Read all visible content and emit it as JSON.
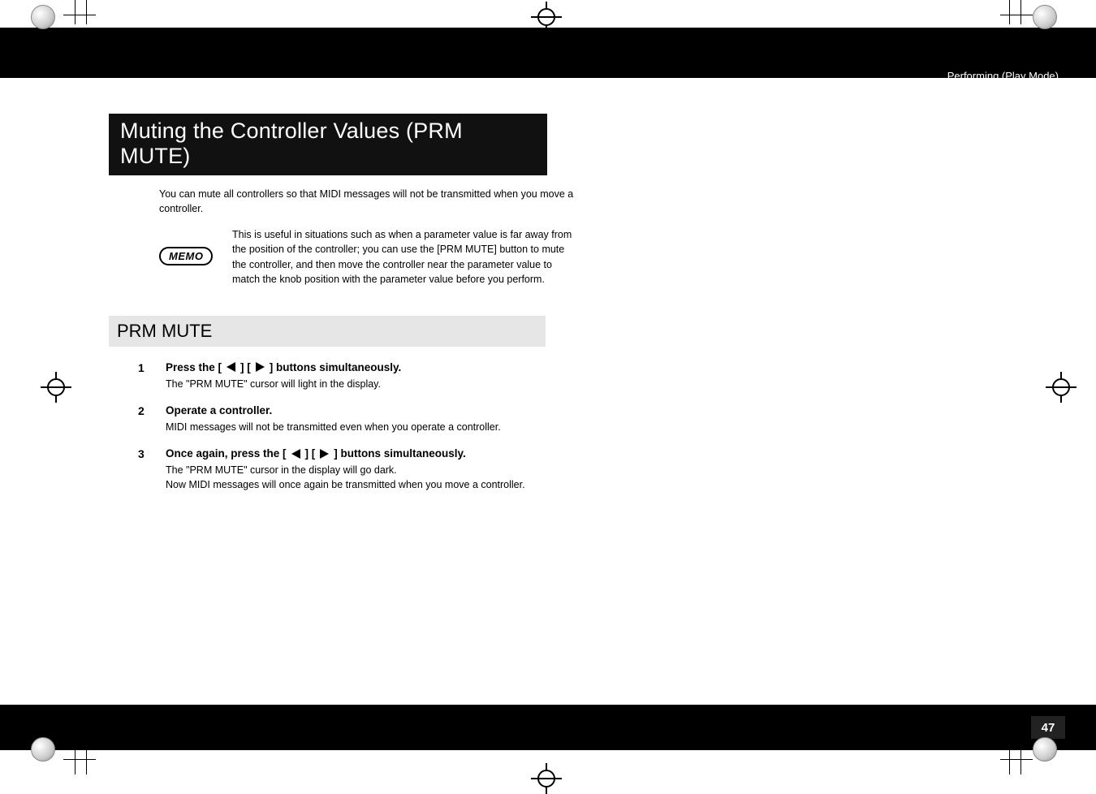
{
  "header": {
    "breadcrumb": "Performing (Play Mode)"
  },
  "main": {
    "title": "Muting the Controller Values (PRM MUTE)",
    "intro": "You can mute all controllers so that MIDI messages will not be transmitted when you move a controller.",
    "memo_label": "MEMO",
    "memo_text": "This is useful in situations such as when a parameter value is far away from the position of the controller; you can use the [PRM MUTE] button to mute the controller, and then move the controller near the parameter value to match the knob position with the parameter value before you perform."
  },
  "section": {
    "title": "PRM MUTE",
    "steps": [
      {
        "num": "1",
        "title_prefix": "Press the [",
        "title_mid": "] [",
        "title_suffix": "] buttons simultaneously.",
        "desc": "The \"PRM MUTE\" cursor will light in the display."
      },
      {
        "num": "2",
        "title_plain": "Operate a controller.",
        "desc": "MIDI messages will not be transmitted even when you operate a controller."
      },
      {
        "num": "3",
        "title_prefix": "Once again, press the [",
        "title_mid": "] [",
        "title_suffix": "] buttons simultaneously.",
        "desc": "The \"PRM MUTE\" cursor in the display will go dark.\nNow MIDI messages will once again be transmitted when you move a controller."
      }
    ]
  },
  "footer": {
    "page_number": "47"
  }
}
